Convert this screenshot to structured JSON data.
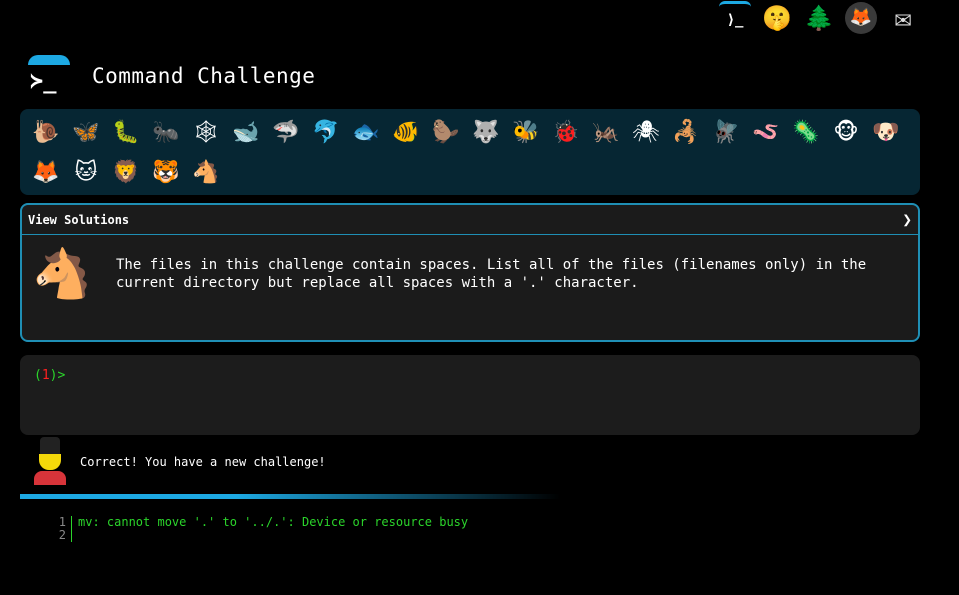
{
  "topnav": {
    "items": [
      {
        "name": "terminal-logo-link",
        "glyph": "⟩_"
      },
      {
        "name": "shush-face-link",
        "glyph": "🤫"
      },
      {
        "name": "tree-link",
        "glyph": "🌲"
      },
      {
        "name": "gitlab-link",
        "glyph": "🦊"
      },
      {
        "name": "mail-link",
        "glyph": "✉"
      }
    ]
  },
  "header": {
    "logo_glyph": "≻_",
    "title": "Command Challenge"
  },
  "levels": [
    {
      "glyph": "🐌",
      "done": true
    },
    {
      "glyph": "🦋",
      "done": true
    },
    {
      "glyph": "🐛",
      "done": true
    },
    {
      "glyph": "🐜",
      "done": true
    },
    {
      "glyph": "🕸",
      "done": true
    },
    {
      "glyph": "🐋",
      "done": true
    },
    {
      "glyph": "🦈",
      "done": true
    },
    {
      "glyph": "🐬",
      "done": true
    },
    {
      "glyph": "🐟",
      "done": true
    },
    {
      "glyph": "🐠",
      "done": true
    },
    {
      "glyph": "🦫",
      "done": true
    },
    {
      "glyph": "🐺",
      "done": true
    },
    {
      "glyph": "🐝",
      "done": true
    },
    {
      "glyph": "🐞",
      "done": true
    },
    {
      "glyph": "🦗",
      "done": true
    },
    {
      "glyph": "🕷",
      "done": true
    },
    {
      "glyph": "🦂",
      "done": true
    },
    {
      "glyph": "🪰",
      "done": true
    },
    {
      "glyph": "🪱",
      "done": true
    },
    {
      "glyph": "🦠",
      "done": true
    },
    {
      "glyph": "🐵",
      "done": true
    },
    {
      "glyph": "🐶",
      "done": true
    },
    {
      "glyph": "🦊",
      "done": true
    },
    {
      "glyph": "🐱",
      "done": true
    },
    {
      "glyph": "🦁",
      "done": true
    },
    {
      "glyph": "🐯",
      "done": true
    },
    {
      "glyph": "🐴",
      "done": true
    }
  ],
  "challenge": {
    "solutions_label": "View Solutions",
    "chevron": "❯",
    "emoji": "🐴",
    "text": "The files in this challenge contain spaces. List all of the files (filenames only) in the current directory but replace all spaces with a '.' character."
  },
  "terminal": {
    "prompt_open": "(",
    "prompt_num": "1",
    "prompt_close": ")>",
    "input_value": ""
  },
  "status": {
    "message": "Correct! You have a new challenge!"
  },
  "output": {
    "line_numbers": [
      "1",
      "2"
    ],
    "lines": [
      "mv: cannot move '.' to '../.': Device or resource busy",
      ""
    ]
  },
  "colors": {
    "accent": "#1da9e3",
    "panel_bg": "#062633",
    "prompt_green": "#2bd42b",
    "prompt_red": "#ff2020"
  }
}
